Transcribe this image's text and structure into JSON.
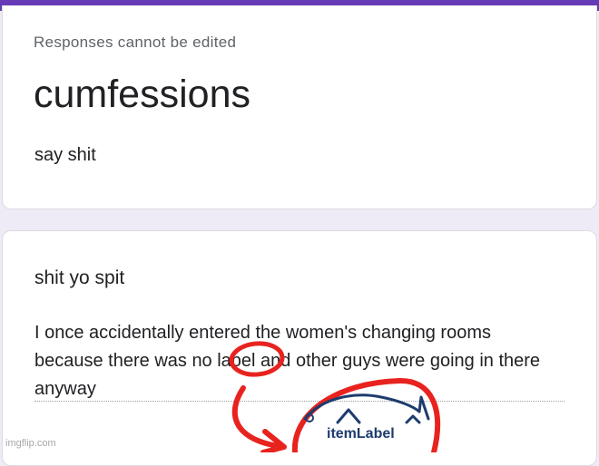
{
  "form": {
    "notice": "Responses cannot be edited",
    "title": "cumfessions",
    "description": "say shit"
  },
  "question": {
    "title": "shit yo spit",
    "answer": "I once accidentally entered the women's changing rooms because there was no label and other guys were going in there anyway"
  },
  "annotation": {
    "logo_text": "itemLabel",
    "ink_color": "#e8231f",
    "logo_color": "#1d3c6e"
  },
  "watermark": "imgflip.com",
  "colors": {
    "accent": "#673ab7",
    "background": "#efebf6"
  }
}
